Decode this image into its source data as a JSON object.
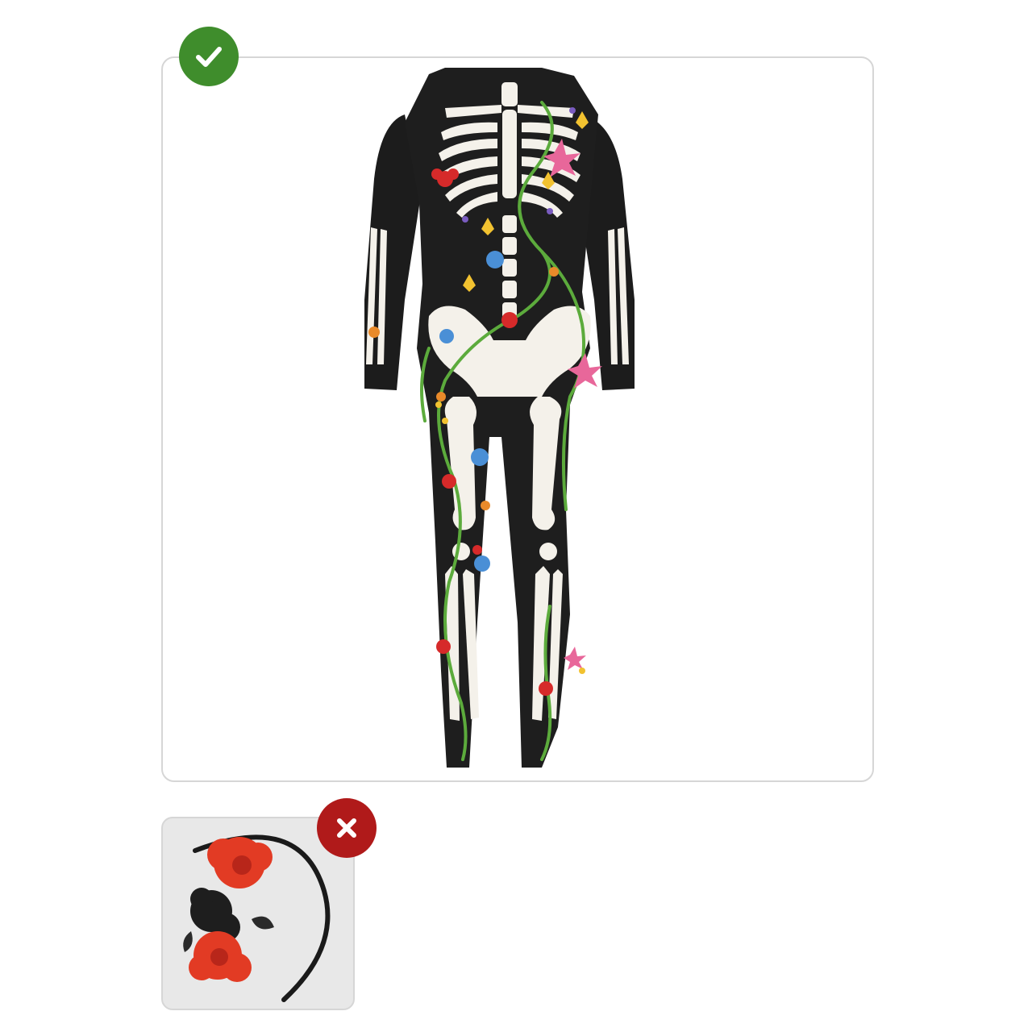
{
  "included_item": {
    "status_icon": "checkmark-icon",
    "status_color": "#3f8d2c",
    "image": "skeleton-jumpsuit-floral"
  },
  "excluded_item": {
    "status_icon": "x-mark-icon",
    "status_color": "#b01a1a",
    "image": "flower-headband-red-black"
  },
  "colors": {
    "border": "#d6d6d6",
    "excluded_background": "#e8e8e8"
  }
}
